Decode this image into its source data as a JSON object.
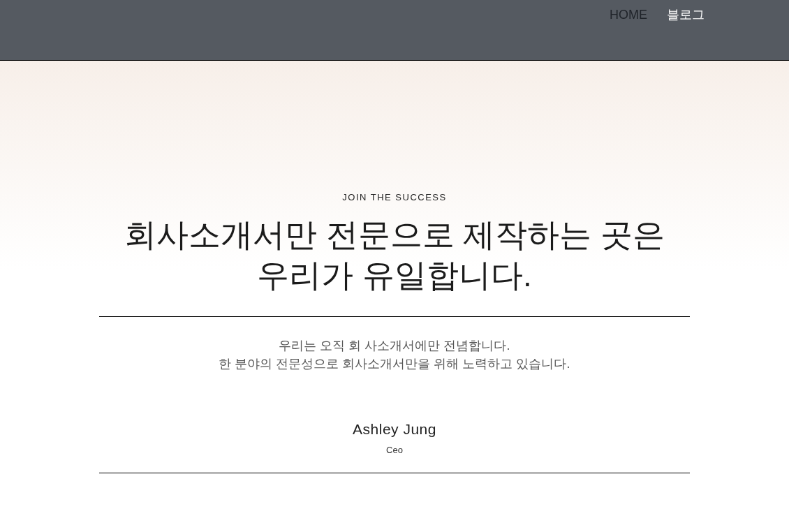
{
  "header": {
    "nav": [
      {
        "label": "HOME",
        "selected": true
      },
      {
        "label": "블로그",
        "selected": false
      }
    ]
  },
  "hero": {
    "eyebrow": "JOIN THE SUCCESS",
    "headline": [
      "회사소개서만 전문으로 제작하는 곳은",
      "우리가 유일합니다."
    ],
    "description": [
      "우리는 오직 회 사소개서에만 전념합니다.",
      "한 분야의 전문성으로 회사소개서만을 위해 노력하고 있습니다."
    ],
    "person": {
      "name": "Ashley Jung",
      "role": "Ceo"
    }
  }
}
